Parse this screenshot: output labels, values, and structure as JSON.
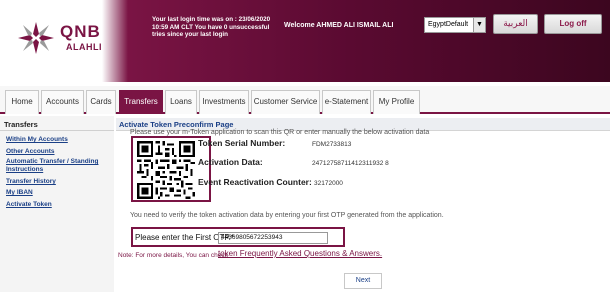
{
  "header": {
    "logo_text": "QNB",
    "logo_sub": "ALAHLI",
    "last_login": "Your last login time was on : 23/06/2020 10:59 AM CLT You have 0 unsuccessful tries since your last login",
    "welcome": "Welcome  AHMED ALI ISMAIL ALI",
    "language_selected": "EgyptDefault",
    "arabic_button": "العربية",
    "logoff_button": "Log off",
    "brand_color": "#7a1444"
  },
  "nav": {
    "tabs": [
      {
        "label": "Home"
      },
      {
        "label": "Accounts"
      },
      {
        "label": "Cards"
      },
      {
        "label": "Transfers",
        "active": true
      },
      {
        "label": "Loans"
      },
      {
        "label": "Investments"
      },
      {
        "label": "Customer Service"
      },
      {
        "label": "e-Statement"
      },
      {
        "label": "My Profile"
      }
    ]
  },
  "sidebar": {
    "title": "Transfers",
    "items": [
      {
        "label": "Within My Accounts"
      },
      {
        "label": "Other Accounts"
      },
      {
        "label": "Automatic Transfer / Standing Instructions"
      },
      {
        "label": "Transfer History"
      },
      {
        "label": "My IBAN"
      },
      {
        "label": "Activate Token"
      }
    ]
  },
  "main": {
    "title": "Activate Token Preconfirm Page",
    "instruction": "Please use your m-Token application to scan this QR or enter manually the below activation data",
    "serial_label": "Token Serial Number:",
    "serial_value": "FDM2733813",
    "activation_label": "Activation Data:",
    "activation_value": "24712758711412311932 8",
    "counter_label": "Event Reactivation Counter:",
    "counter_value": "32172000",
    "verify_text": "You need to verify the token activation data by entering your first OTP generated from the application.",
    "otp_label": "Please enter the First OTP.*",
    "otp_value": "44369805672253943",
    "note_text": "Note: For more details, You can check",
    "note_link": "token Frequently Asked Questions & Answers.",
    "next_button": "Next"
  }
}
